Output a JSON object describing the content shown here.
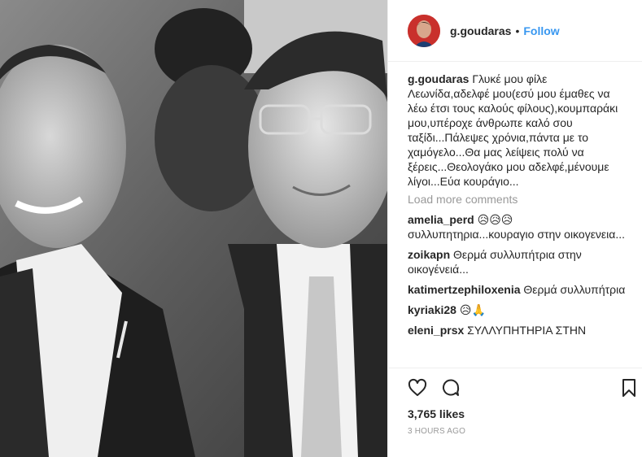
{
  "post": {
    "username": "g.goudaras",
    "separator": "•",
    "follow_label": "Follow",
    "caption": "Γλυκέ μου φίλε Λεωνίδα,αδελφέ μου(εσύ μου έμαθες να λέω έτσι τους καλούς φίλους),κουμπαράκι μου,υπέροχε άνθρωπε καλό σου ταξίδι...Πάλεψες χρόνια,πάντα με το χαμόγελο...Θα μας λείψεις πολύ να ξέρεις...Θεολογάκο μου αδελφέ,μένουμε λίγοι...Εύα κουράγιο...",
    "load_more": "Load more comments",
    "likes": "3,765 likes",
    "time": "3 HOURS AGO"
  },
  "comments": [
    {
      "user": "amelia_perd",
      "text": "😥😥😥 συλλυπητηρια...κουραγιο στην οικογενεια..."
    },
    {
      "user": "zoikapn",
      "text": "Θερμά συλλυπήτρια στην οικογένειά..."
    },
    {
      "user": "katimertzephiloxenia",
      "text": "Θερμά συλλυπήτρια"
    },
    {
      "user": "kyriaki28",
      "text": "😥🙏"
    },
    {
      "user": "eleni_prsx",
      "text": "ΣΥΛΛΥΠΗΤΗΡΙΑ ΣΤΗΝ"
    }
  ],
  "icons": {
    "like": "heart-outline-icon",
    "comment": "speech-bubble-icon",
    "save": "bookmark-outline-icon"
  },
  "colors": {
    "link": "#3897f0",
    "text": "#262626",
    "muted": "#999999",
    "border": "#efefef"
  }
}
